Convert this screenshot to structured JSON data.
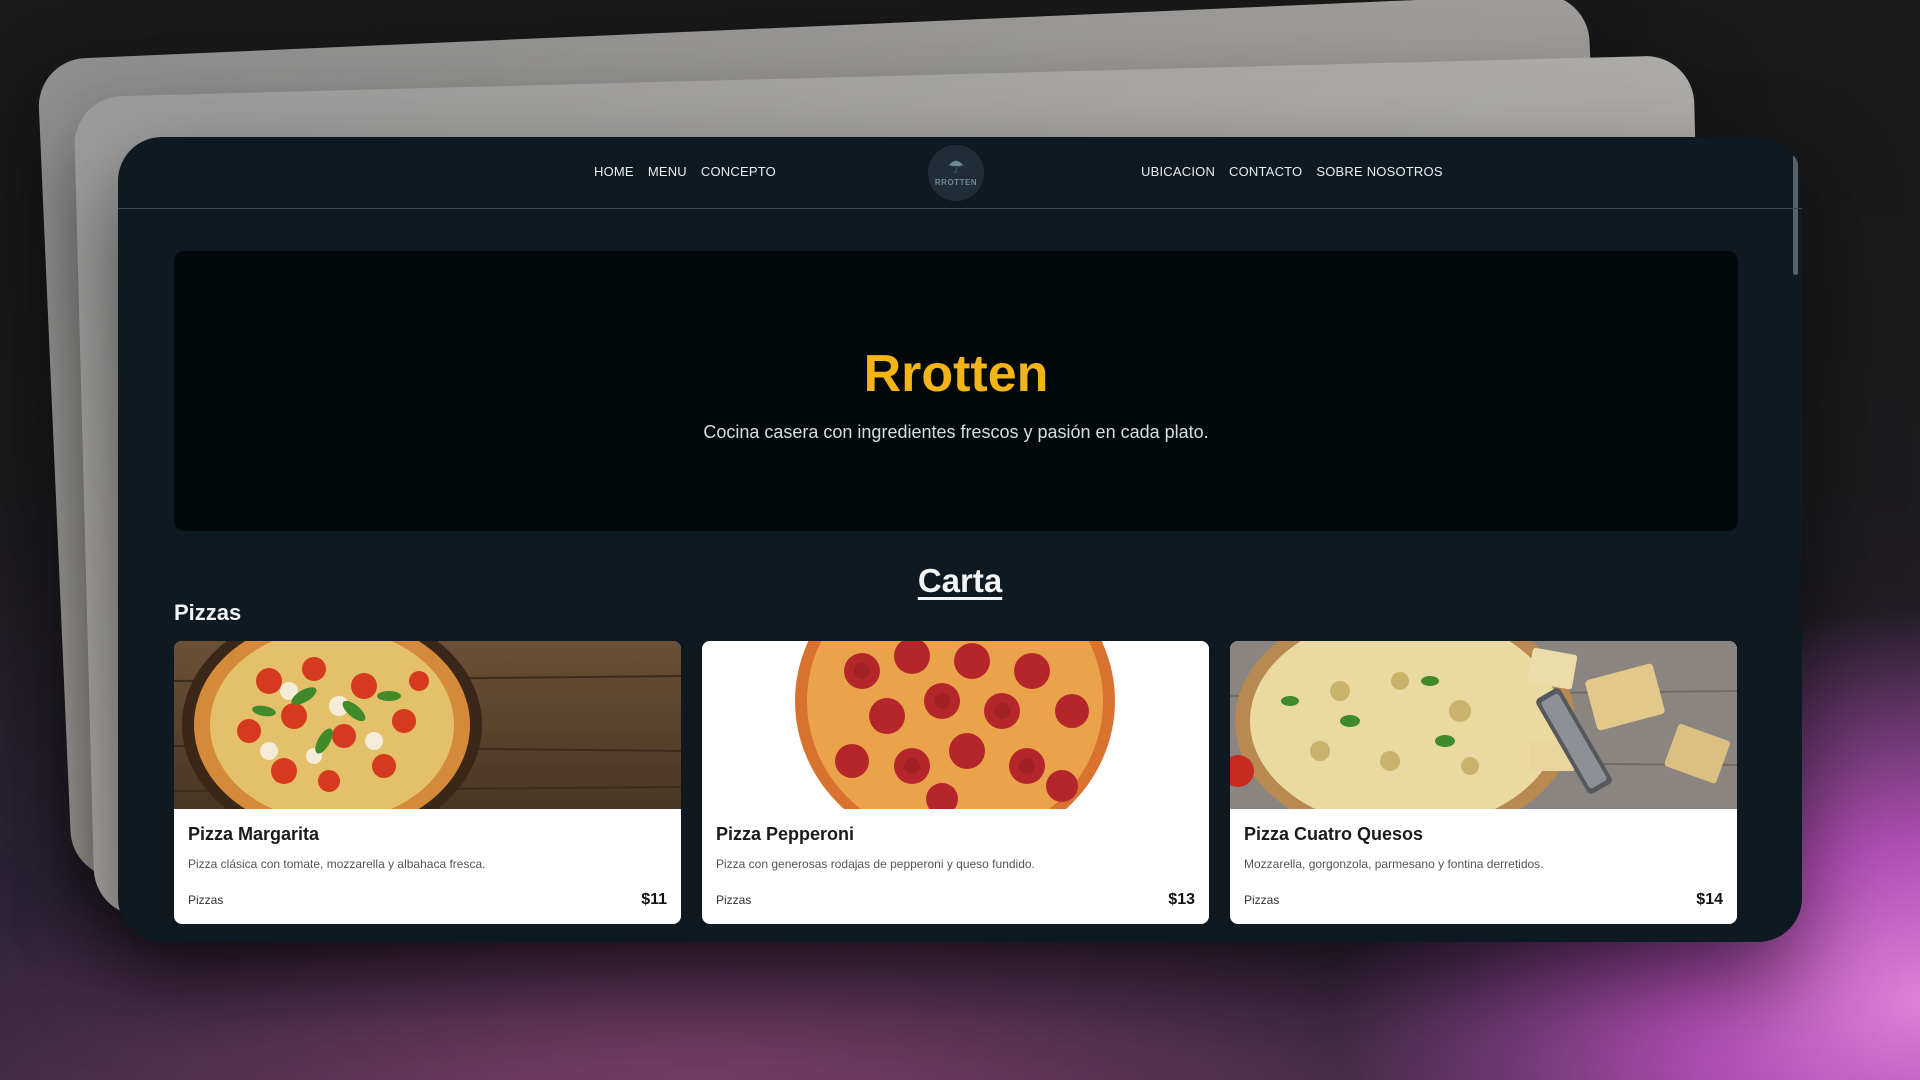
{
  "nav": {
    "left": [
      "HOME",
      "MENU",
      "CONCEPTO"
    ],
    "right": [
      "UBICACION",
      "CONTACTO",
      "SOBRE NOSOTROS"
    ],
    "logo_text": "RROTTEN"
  },
  "hero": {
    "title": "Rrotten",
    "subtitle": "Cocina casera con ingredientes frescos y pasión en cada plato."
  },
  "menu": {
    "title": "Carta",
    "category": "Pizzas",
    "items": [
      {
        "name": "Pizza Margarita",
        "description": "Pizza clásica con tomate, mozzarella y albahaca fresca.",
        "category": "Pizzas",
        "price": "$11"
      },
      {
        "name": "Pizza Pepperoni",
        "description": "Pizza con generosas rodajas de pepperoni y queso fundido.",
        "category": "Pizzas",
        "price": "$13"
      },
      {
        "name": "Pizza Cuatro Quesos",
        "description": "Mozzarella, gorgonzola, parmesano y fontina derretidos.",
        "category": "Pizzas",
        "price": "$14"
      }
    ]
  },
  "colors": {
    "accent": "#f2b515",
    "page_bg": "#0f1921",
    "hero_bg": "#03090b"
  }
}
